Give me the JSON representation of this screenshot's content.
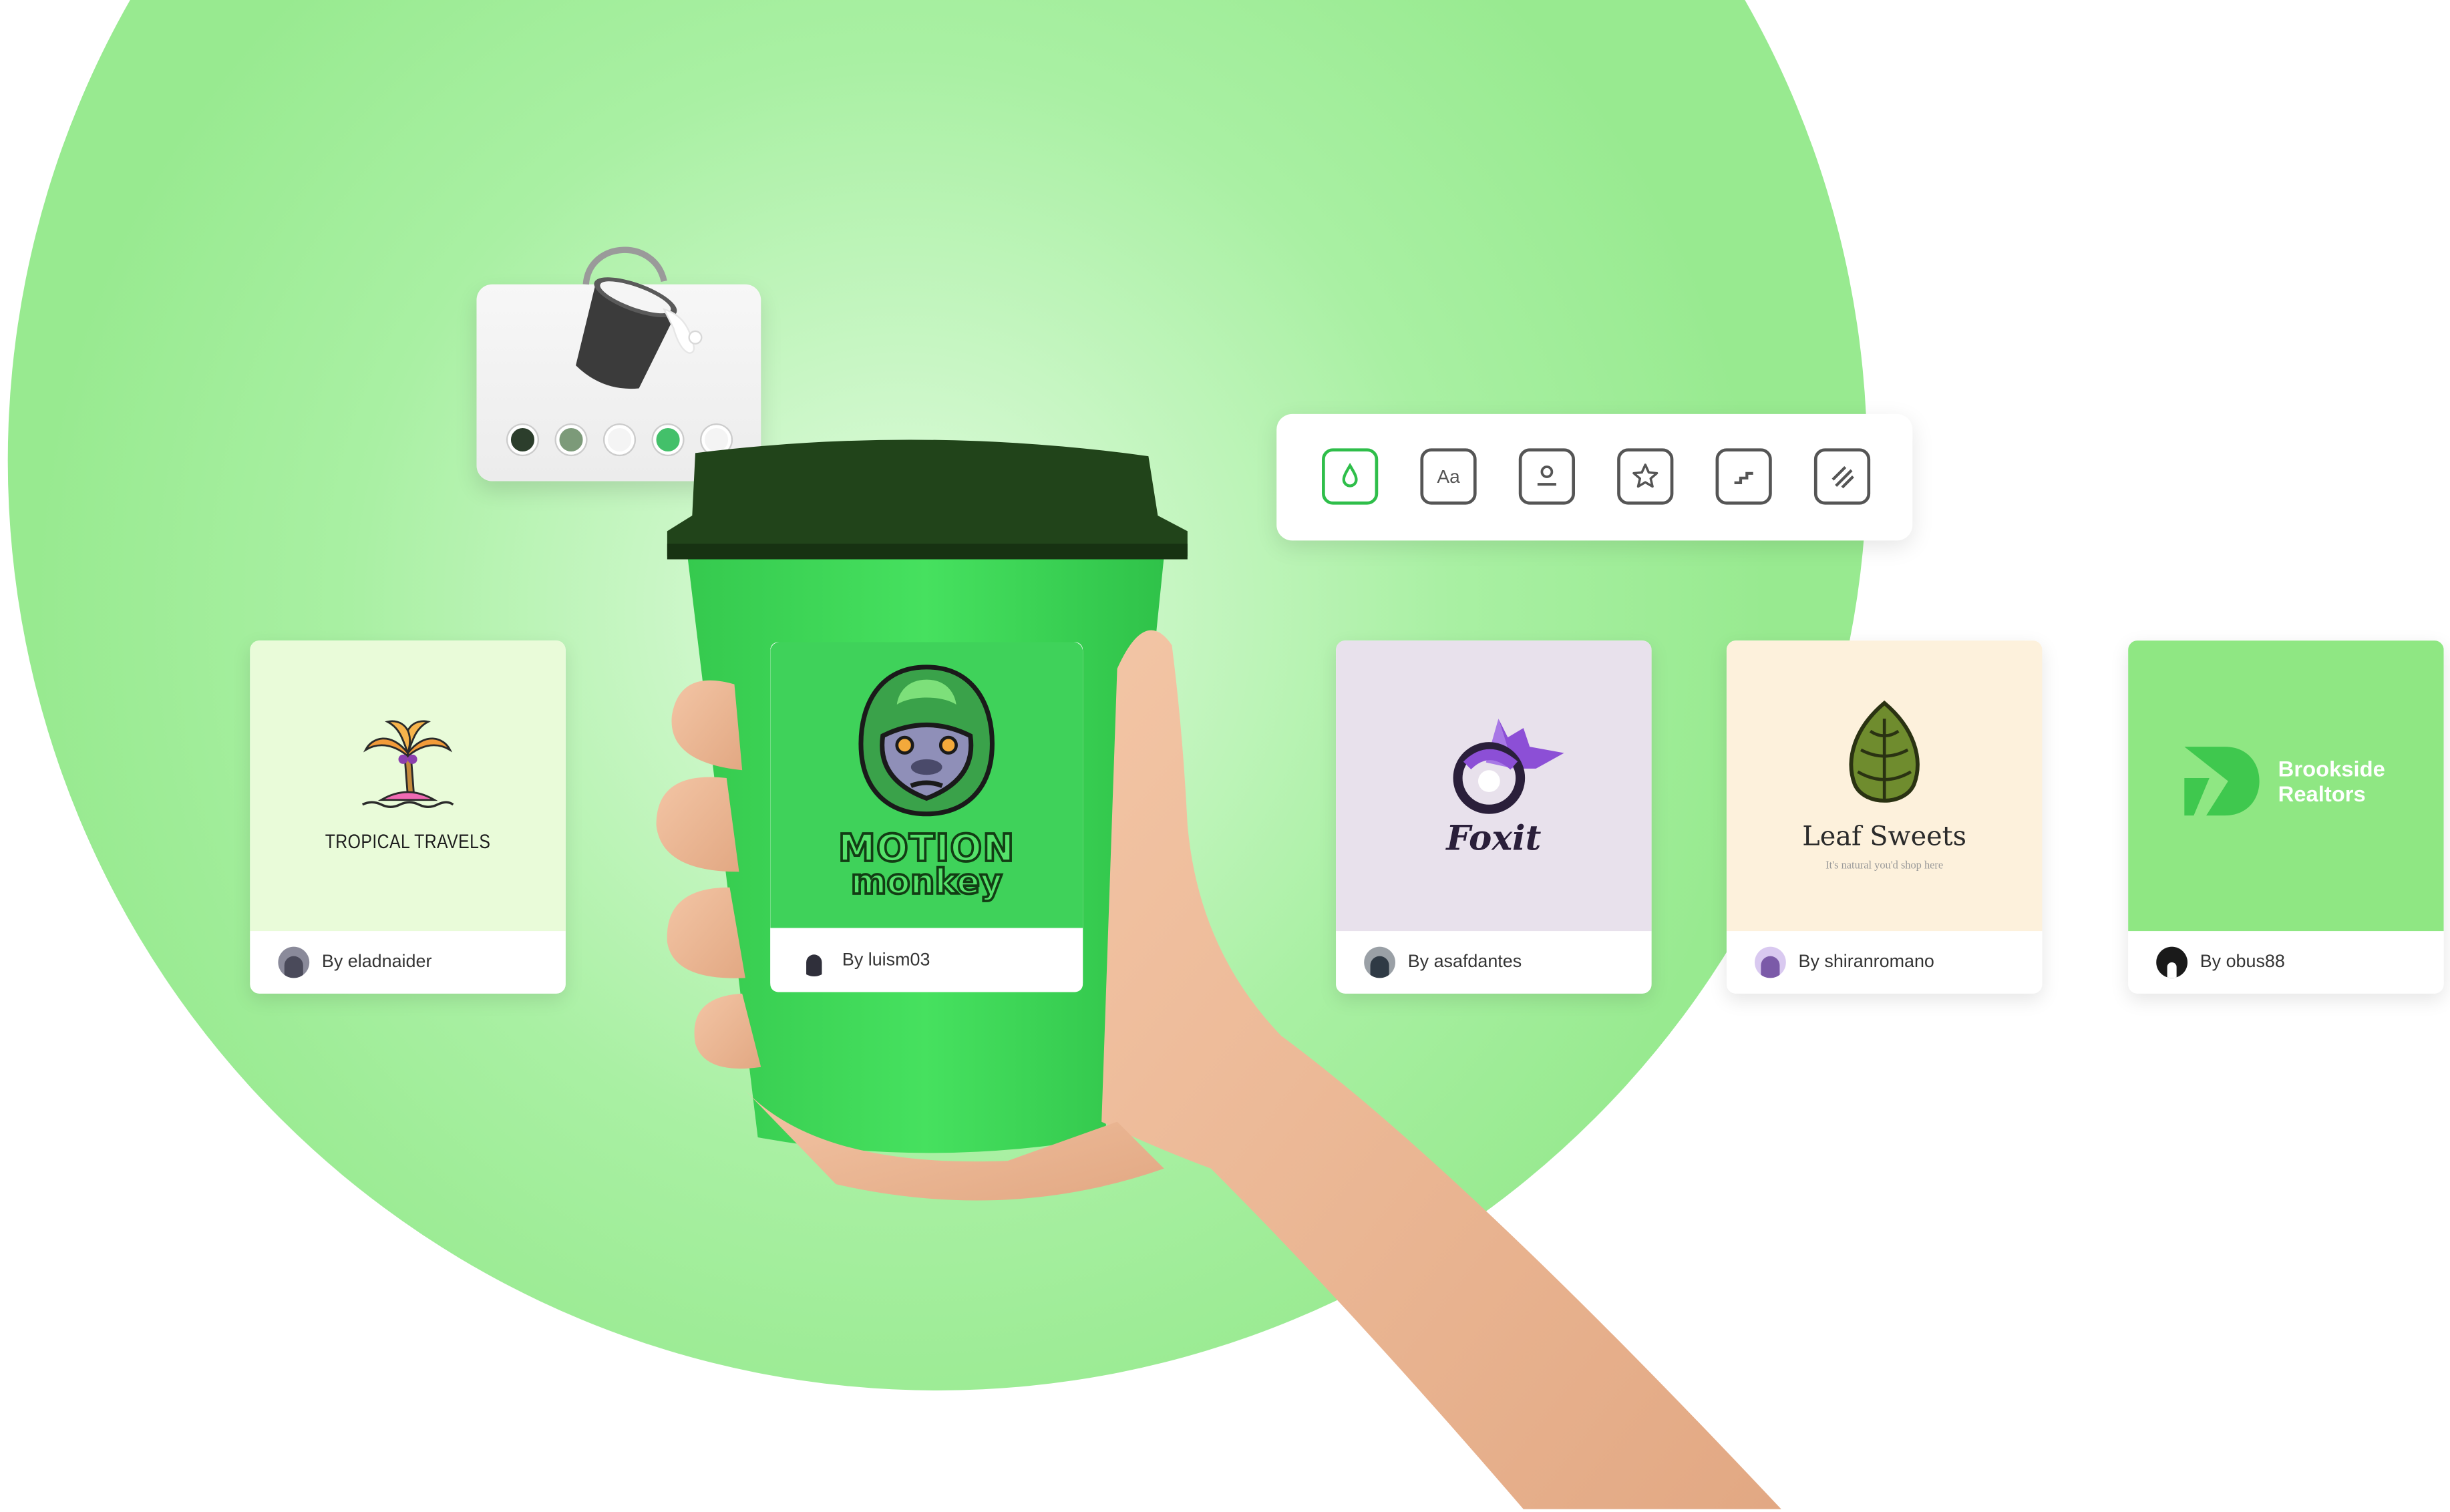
{
  "colors": {
    "circle": "#97ea8f",
    "accent": "#2fbe4a",
    "cup": "#3fe05a",
    "lid": "#1f3d17"
  },
  "palette": {
    "icon": "paint-bucket-icon",
    "swatches": [
      "#2c3e2c",
      "#7c9a79",
      "#f4f4f4",
      "#43c06a",
      "#f4f4f4"
    ]
  },
  "toolbar": {
    "tools": [
      {
        "icon": "color-drop-icon",
        "active": true
      },
      {
        "icon": "font-icon",
        "label": "Aa",
        "active": false
      },
      {
        "icon": "logo-icon",
        "active": false
      },
      {
        "icon": "star-icon",
        "active": false
      },
      {
        "icon": "layout-icon",
        "active": false
      },
      {
        "icon": "pattern-icon",
        "active": false
      }
    ]
  },
  "cards": [
    {
      "name": "TROPICAL TRAVELS",
      "tagline": "",
      "author": "By eladnaider",
      "bg": "#e9fbd9"
    },
    {
      "name": "MOTION",
      "name2": "monkey",
      "author": "By luism03",
      "bg": "#3fd25a"
    },
    {
      "name": "Foxit",
      "author": "By asafdantes",
      "bg": "#e8e1ec"
    },
    {
      "name": "Leaf Sweets",
      "tagline": "It's natural you'd shop here",
      "author": "By shiranromano",
      "bg": "#fdf1dc"
    },
    {
      "name": "Brookside",
      "name2": "Realtors",
      "author": "By obus88",
      "bg": "#8fe783"
    }
  ]
}
